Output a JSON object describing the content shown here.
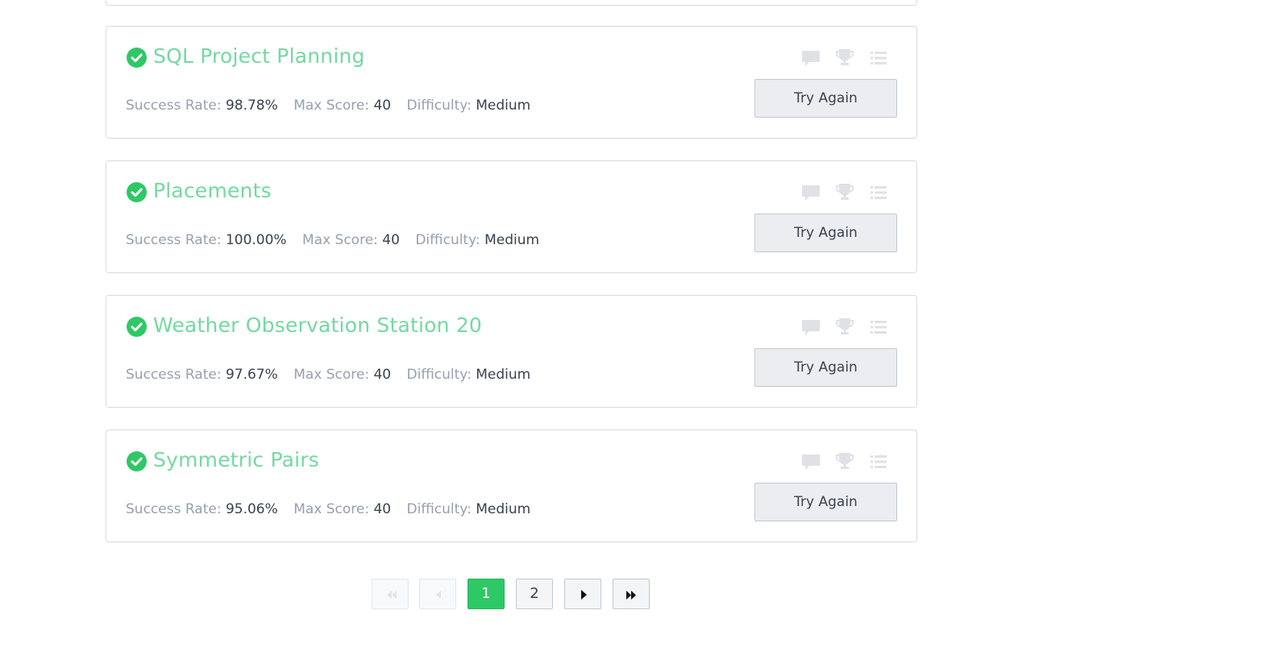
{
  "challenges": [
    {
      "title": "SQL Project Planning",
      "success_rate_label": "Success Rate:",
      "success_rate": "98.78%",
      "max_score_label": "Max Score:",
      "max_score": "40",
      "difficulty_label": "Difficulty:",
      "difficulty": "Medium",
      "button_label": "Try Again"
    },
    {
      "title": "Placements",
      "success_rate_label": "Success Rate:",
      "success_rate": "100.00%",
      "max_score_label": "Max Score:",
      "max_score": "40",
      "difficulty_label": "Difficulty:",
      "difficulty": "Medium",
      "button_label": "Try Again"
    },
    {
      "title": "Weather Observation Station 20",
      "success_rate_label": "Success Rate:",
      "success_rate": "97.67%",
      "max_score_label": "Max Score:",
      "max_score": "40",
      "difficulty_label": "Difficulty:",
      "difficulty": "Medium",
      "button_label": "Try Again"
    },
    {
      "title": "Symmetric Pairs",
      "success_rate_label": "Success Rate:",
      "success_rate": "95.06%",
      "max_score_label": "Max Score:",
      "max_score": "40",
      "difficulty_label": "Difficulty:",
      "difficulty": "Medium",
      "button_label": "Try Again"
    }
  ],
  "icons": {
    "solved": "check-circle-icon",
    "discussions": "comment-icon",
    "leaderboard": "trophy-icon",
    "editorial": "list-icon"
  },
  "pagination": {
    "pages": [
      "1",
      "2"
    ],
    "current_page": "1"
  },
  "colors": {
    "accent_green": "#2ec866",
    "title_green": "#74d9a0",
    "muted_icon": "#dfe1e6",
    "label_gray": "#979faf",
    "value_dark": "#39424e"
  }
}
